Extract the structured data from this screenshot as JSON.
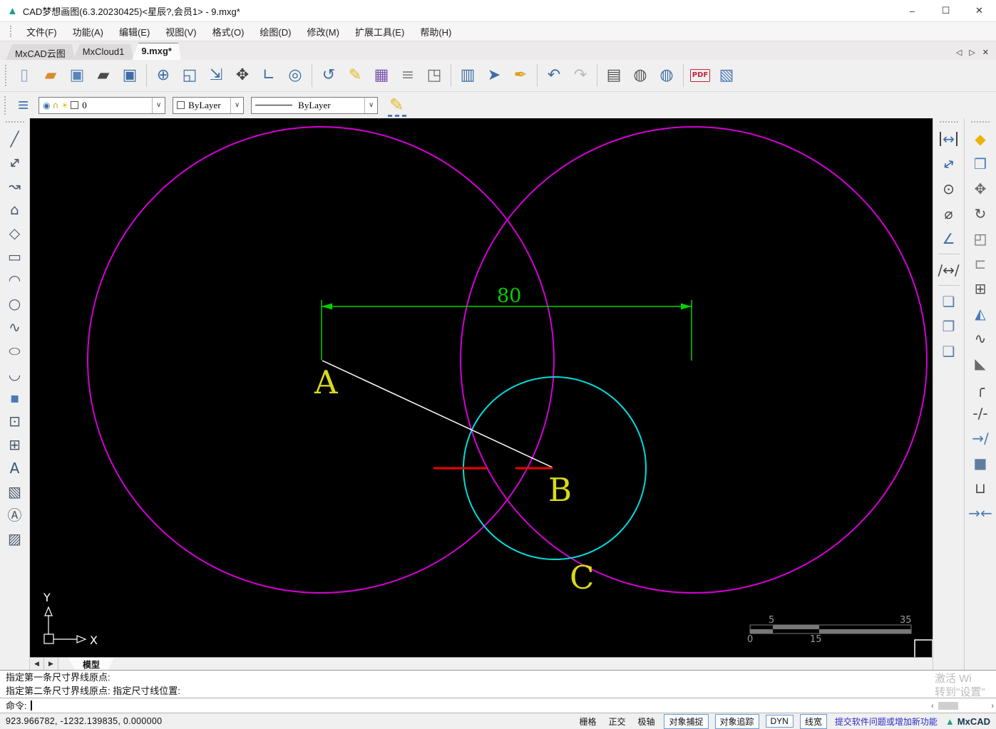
{
  "window": {
    "title": "CAD梦想画图(6.3.20230425)<星辰?,会员1> - 9.mxg*",
    "controls": {
      "minimize": "–",
      "maximize": "☐",
      "close": "✕"
    }
  },
  "menu": {
    "items": [
      {
        "name": "menu-file",
        "label": "文件(F)"
      },
      {
        "name": "menu-function",
        "label": "功能(A)"
      },
      {
        "name": "menu-edit",
        "label": "编辑(E)"
      },
      {
        "name": "menu-view",
        "label": "视图(V)"
      },
      {
        "name": "menu-format",
        "label": "格式(O)"
      },
      {
        "name": "menu-draw",
        "label": "绘图(D)"
      },
      {
        "name": "menu-modify",
        "label": "修改(M)"
      },
      {
        "name": "menu-ext-tools",
        "label": "扩展工具(E)"
      },
      {
        "name": "menu-help",
        "label": "帮助(H)"
      }
    ]
  },
  "tabs": {
    "items": [
      {
        "name": "tab-mxcad-cloud",
        "label": "MxCAD云图"
      },
      {
        "name": "tab-mxcloud1",
        "label": "MxCloud1"
      },
      {
        "name": "tab-9mxg",
        "label": "9.mxg*",
        "active": true
      }
    ],
    "scroll_left": "◁",
    "scroll_right": "▷",
    "close": "✕"
  },
  "toolbar": {
    "items": [
      {
        "name": "new-file-icon",
        "glyph": "▯",
        "color": "#8fa8c4"
      },
      {
        "name": "open-cloud-icon",
        "glyph": "▰",
        "color": "#d98c2b"
      },
      {
        "name": "save-icon",
        "glyph": "▣",
        "color": "#5b87b8"
      },
      {
        "name": "open-file-icon",
        "glyph": "▰",
        "color": "#4a4a4a"
      },
      {
        "name": "save-as-icon",
        "glyph": "▣",
        "color": "#3f6ea5"
      },
      {
        "sep": true
      },
      {
        "name": "zoom-in-out-icon",
        "glyph": "⊕"
      },
      {
        "name": "zoom-window-icon",
        "glyph": "◱"
      },
      {
        "name": "zoom-extents-icon",
        "glyph": "⇲"
      },
      {
        "name": "pan-icon",
        "glyph": "✥",
        "color": "#444444"
      },
      {
        "name": "ucs-axes-icon",
        "glyph": "∟"
      },
      {
        "name": "zoom-dynamic-icon",
        "glyph": "◎"
      },
      {
        "sep": true
      },
      {
        "name": "zoom-previous-icon",
        "glyph": "↺"
      },
      {
        "name": "sketch-pencil-icon",
        "glyph": "✎",
        "color": "#e3b71e"
      },
      {
        "name": "color-palette-icon",
        "glyph": "▦",
        "color": "#7a52b0"
      },
      {
        "name": "layer-manager-icon",
        "glyph": "≡",
        "color": "#8a8a8a"
      },
      {
        "name": "block-edit-icon",
        "glyph": "◳",
        "color": "#6b6b6b"
      },
      {
        "sep": true
      },
      {
        "name": "text-style-icon",
        "glyph": "▥"
      },
      {
        "name": "quick-select-icon",
        "glyph": "➤"
      },
      {
        "name": "match-properties-icon",
        "glyph": "✒",
        "color": "#d9a21b"
      },
      {
        "sep": true
      },
      {
        "name": "undo-icon",
        "glyph": "↶",
        "color": "#3f6ea5"
      },
      {
        "name": "redo-icon",
        "glyph": "↷",
        "color": "#b9b9b9"
      },
      {
        "sep": true
      },
      {
        "name": "print-icon",
        "glyph": "▤",
        "color": "#555555"
      },
      {
        "name": "publish-web-icon",
        "glyph": "◍",
        "color": "#555555"
      },
      {
        "name": "web-edit-icon",
        "glyph": "◍",
        "color": "#3f6ea5"
      },
      {
        "sep": true
      },
      {
        "name": "export-pdf-icon",
        "glyph": "PDF",
        "color": "#c6223b",
        "cls": "txtglyph"
      },
      {
        "name": "export-image-icon",
        "glyph": "▧",
        "color": "#4a7ab5"
      }
    ]
  },
  "properties_bar": {
    "layers_icon": "≡",
    "layer": {
      "eye_icon": "◉",
      "lock_icon": "∩",
      "bulb_icon": "☀",
      "value": "0"
    },
    "color": {
      "value": "ByLayer"
    },
    "linetype": {
      "value": "ByLayer"
    },
    "dropdown_arrow": "∨",
    "pencil_icon": "✎"
  },
  "left_toolbar": {
    "items": [
      {
        "name": "line-icon",
        "glyph": "╱"
      },
      {
        "name": "construction-line-icon",
        "glyph": "↔",
        "cls": "rot-45"
      },
      {
        "name": "polyline-icon",
        "glyph": "↝"
      },
      {
        "name": "polygon-icon",
        "glyph": "⌂"
      },
      {
        "name": "polygon2-icon",
        "glyph": "◇"
      },
      {
        "name": "rectangle-icon",
        "glyph": "▭"
      },
      {
        "name": "arc-icon",
        "glyph": "◠"
      },
      {
        "name": "circle-icon",
        "glyph": "○"
      },
      {
        "name": "spline-icon",
        "glyph": "∿"
      },
      {
        "name": "ellipse-icon",
        "glyph": "○",
        "cls": "squash"
      },
      {
        "name": "ellipse-arc-icon",
        "glyph": "◡"
      },
      {
        "name": "point-icon",
        "glyph": "▪",
        "color": "#4a7ab5"
      },
      {
        "name": "insert-block-icon",
        "glyph": "⊡"
      },
      {
        "name": "create-block-icon",
        "glyph": "⊞"
      },
      {
        "name": "text-icon",
        "glyph": "A",
        "color": "#35567a"
      },
      {
        "name": "image-icon",
        "glyph": "▧"
      },
      {
        "name": "mtext-icon",
        "glyph": "Ⓐ"
      },
      {
        "name": "hatch-icon",
        "glyph": "▨"
      }
    ]
  },
  "right_dim_toolbar": {
    "items": [
      {
        "name": "dim-linear-icon",
        "glyph": "↔",
        "cls": "bars",
        "color": "#3f6ea5"
      },
      {
        "name": "dim-aligned-icon",
        "glyph": "↔",
        "cls": "rot35",
        "color": "#3f6ea5"
      },
      {
        "name": "dim-radius-icon",
        "glyph": "⊙"
      },
      {
        "name": "dim-diameter-icon",
        "glyph": "⌀"
      },
      {
        "name": "dim-angular-icon",
        "glyph": "∠",
        "color": "#3f6ea5"
      },
      {
        "sep": true
      },
      {
        "name": "dim-quick-icon",
        "glyph": "∕↔∕",
        "cls": "sm"
      },
      {
        "sep": true
      },
      {
        "name": "dim-edit-icon",
        "glyph": "❏",
        "color": "#5b7fa8"
      },
      {
        "name": "dim-text-edit-icon",
        "glyph": "❐",
        "color": "#5b7fa8"
      },
      {
        "name": "dim-update-icon",
        "glyph": "❑",
        "color": "#5b7fa8"
      }
    ]
  },
  "right_modify_toolbar": {
    "items": [
      {
        "name": "erase-icon",
        "glyph": "◆",
        "color": "#eab30a"
      },
      {
        "name": "copy-icon",
        "glyph": "❒",
        "color": "#4a7ab5"
      },
      {
        "name": "move-icon",
        "glyph": "✥",
        "color": "#6b6b6b"
      },
      {
        "name": "rotate-icon",
        "glyph": "↻",
        "color": "#555555"
      },
      {
        "name": "stretch-icon",
        "glyph": "◰",
        "color": "#6b6b6b"
      },
      {
        "name": "offset-icon",
        "glyph": "⊏",
        "color": "#8a8a8a"
      },
      {
        "name": "array-icon",
        "glyph": "⊞",
        "color": "#555555"
      },
      {
        "name": "mirror-icon",
        "glyph": "◭",
        "color": "#4a7ab5"
      },
      {
        "name": "edit-spline-icon",
        "glyph": "∿"
      },
      {
        "name": "chamfer-icon",
        "glyph": "◣",
        "color": "#6b6b6b"
      },
      {
        "name": "fillet-icon",
        "glyph": "╭"
      },
      {
        "name": "break-icon",
        "glyph": "-∕-",
        "cls": "sm"
      },
      {
        "name": "trim-icon",
        "glyph": "→∕",
        "cls": "sm",
        "color": "#4a7ab5"
      },
      {
        "name": "explode-icon",
        "glyph": "■",
        "color": "#607d9e"
      },
      {
        "name": "join-icon",
        "glyph": "⊔"
      },
      {
        "name": "snap-together-icon",
        "glyph": "→←",
        "cls": "sm",
        "color": "#4a7ab5"
      }
    ]
  },
  "canvas": {
    "colors": {
      "magenta": "#d400d4",
      "cyan": "#00dcdc",
      "green": "#00d200",
      "red": "#f00000",
      "white": "#ffffff",
      "yellow": "#d9d919"
    },
    "dimension": {
      "value": "80"
    },
    "labels": {
      "a": "A",
      "b": "B",
      "c": "C"
    },
    "ucs": {
      "x_label": "X",
      "y_label": "Y"
    },
    "scale_bar": {
      "top_left": "5",
      "top_right": "35",
      "bottom_left": "0",
      "bottom_mid": "15"
    }
  },
  "model_bar": {
    "prev": "◀",
    "next": "▶",
    "tab": "模型"
  },
  "command": {
    "lines": [
      "指定第一条尺寸界线原点:",
      "指定第二条尺寸界线原点:  指定尺寸线位置:"
    ],
    "prompt": "命令:",
    "scroll_left": "‹",
    "scroll_right": "›"
  },
  "watermark": {
    "line1": "激活 Wi",
    "line2": "转到\"设置\""
  },
  "status_bar": {
    "coordinates": "923.966782,  -1232.139835,  0.000000",
    "toggles": [
      {
        "name": "toggle-grid",
        "label": "栅格"
      },
      {
        "name": "toggle-ortho",
        "label": "正交"
      },
      {
        "name": "toggle-polar",
        "label": "极轴"
      },
      {
        "name": "toggle-osnap",
        "label": "对象捕捉",
        "cls": "boxed"
      },
      {
        "name": "toggle-otrack",
        "label": "对象追踪",
        "cls": "boxed"
      },
      {
        "name": "toggle-dyn",
        "label": "DYN",
        "cls": "boxed"
      },
      {
        "name": "toggle-lineweight",
        "label": "线宽",
        "cls": "boxed"
      }
    ],
    "link": "提交软件问题或增加新功能",
    "brand": "MxCAD"
  }
}
